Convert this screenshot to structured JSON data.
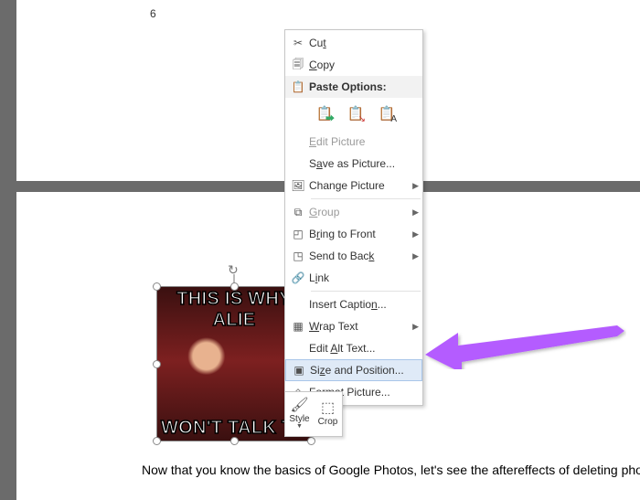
{
  "page": {
    "number": "6"
  },
  "image": {
    "meme_top": "THIS IS WHY ALIE",
    "meme_bottom": "WON'T TALK TO"
  },
  "body_text": "Now that you know the basics of Google Photos, let's see the aftereffects of deleting photos",
  "menu": {
    "cut": "Cut",
    "copy": "Copy",
    "paste_options": "Paste Options:",
    "edit_picture": "Edit Picture",
    "save_as_picture": "Save as Picture...",
    "change_picture": "Change Picture",
    "group": "Group",
    "bring_to_front": "Bring to Front",
    "send_to_back": "Send to Back",
    "link": "Link",
    "insert_caption": "Insert Caption...",
    "wrap_text": "Wrap Text",
    "edit_alt_text": "Edit Alt Text...",
    "size_and_position": "Size and Position...",
    "format_picture": "Format Picture..."
  },
  "tools": {
    "style": "Style",
    "crop": "Crop"
  }
}
